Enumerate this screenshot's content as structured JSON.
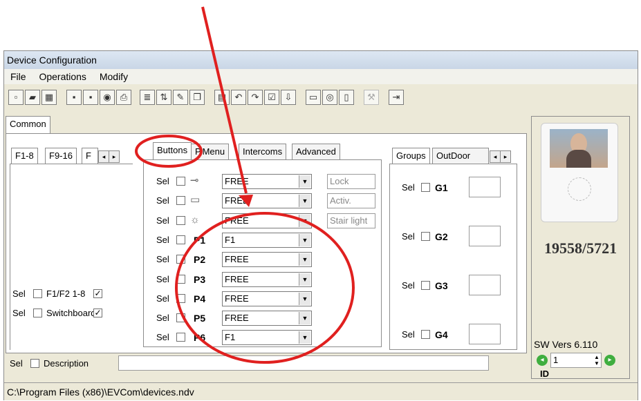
{
  "window": {
    "title": "Device Configuration"
  },
  "menu": {
    "file": "File",
    "operations": "Operations",
    "modify": "Modify"
  },
  "tabs": {
    "common": "Common",
    "f1_8": "F1-8",
    "f9_16": "F9-16",
    "f_trunc": "F",
    "buttons": "Buttons",
    "pmenu": "P.Menu",
    "intercoms": "Intercoms",
    "advanced": "Advanced",
    "groups": "Groups",
    "outdoor": "OutDoor"
  },
  "sel_label": "Sel",
  "buttons_rows": [
    {
      "icon": "key-icon",
      "label": "",
      "value": "FREE",
      "action": "Lock"
    },
    {
      "icon": "contact-icon",
      "label": "",
      "value": "FREE",
      "action": "Activ."
    },
    {
      "icon": "light-icon",
      "label": "",
      "value": "FREE",
      "action": "Stair light"
    },
    {
      "icon": "",
      "label": "P1",
      "value": "F1",
      "action": ""
    },
    {
      "icon": "",
      "label": "P2",
      "value": "FREE",
      "action": ""
    },
    {
      "icon": "",
      "label": "P3",
      "value": "FREE",
      "action": ""
    },
    {
      "icon": "",
      "label": "P4",
      "value": "FREE",
      "action": ""
    },
    {
      "icon": "",
      "label": "P5",
      "value": "FREE",
      "action": ""
    },
    {
      "icon": "",
      "label": "P6",
      "value": "F1",
      "action": ""
    }
  ],
  "left_panel": {
    "f1f2": "F1/F2 1-8",
    "switchboard": "Switchboard"
  },
  "groups": [
    "G1",
    "G2",
    "G3",
    "G4"
  ],
  "device": {
    "model": "19558/5721",
    "sw_version": "SW Vers 6.110",
    "id_value": "1",
    "id_label": "ID"
  },
  "description_label": "Description",
  "status_path": "C:\\Program Files (x86)\\EVCom\\devices.ndv",
  "colors": {
    "annotation_red": "#e0201f",
    "title_bg": "#cfdbea"
  }
}
